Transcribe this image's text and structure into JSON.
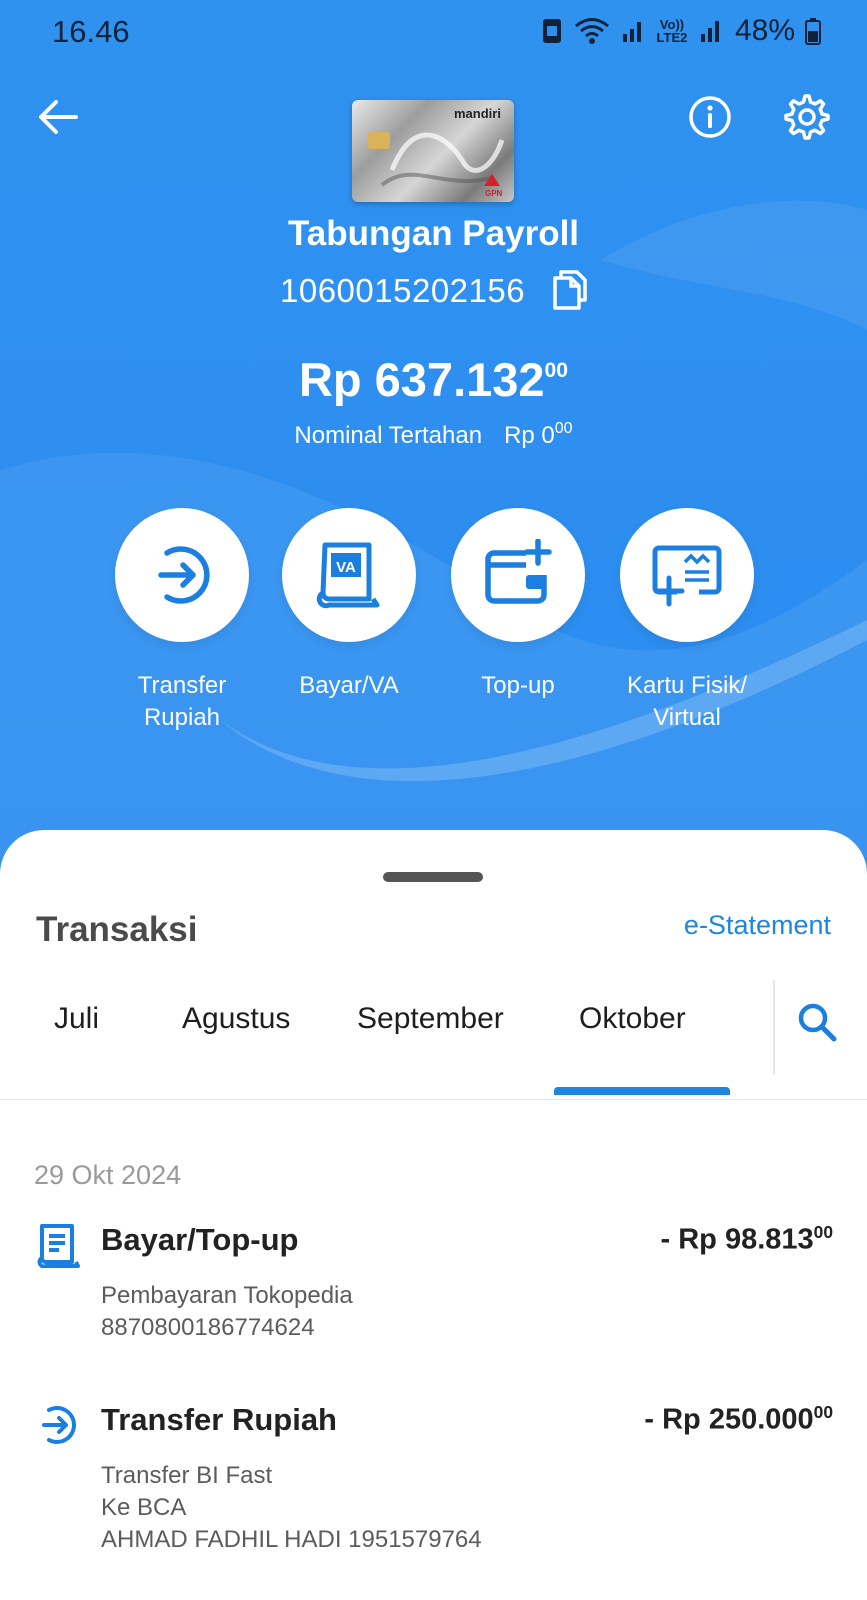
{
  "status_bar": {
    "time": "16.46",
    "network_label": "Vo)) LTE2",
    "battery": "48%"
  },
  "account": {
    "name": "Tabungan Payroll",
    "number": "1060015202156",
    "card_brand": "mandiri",
    "card_network": "GPN"
  },
  "balance": {
    "amount": "Rp 637.132",
    "decimals": "00",
    "hold_label": "Nominal Tertahan",
    "hold_amount": "Rp 0",
    "hold_decimals": "00"
  },
  "actions": [
    {
      "label": "Transfer\nRupiah",
      "icon": "transfer-icon"
    },
    {
      "label": "Bayar/VA",
      "icon": "va-icon"
    },
    {
      "label": "Top-up",
      "icon": "wallet-plus-icon"
    },
    {
      "label": "Kartu Fisik/\nVirtual",
      "icon": "card-plus-icon"
    }
  ],
  "transactions_panel": {
    "title": "Transaksi",
    "estatement_label": "e-Statement",
    "tabs": [
      "Juli",
      "Agustus",
      "September",
      "Oktober"
    ],
    "active_tab": "Oktober",
    "date": "29 Okt 2024",
    "items": [
      {
        "title": "Bayar/Top-up",
        "amount": "- Rp 98.813",
        "decimals": "00",
        "lines": [
          "Pembayaran Tokopedia",
          "8870800186774624"
        ],
        "icon": "receipt-icon"
      },
      {
        "title": "Transfer Rupiah",
        "amount": "- Rp 250.000",
        "decimals": "00",
        "lines": [
          "Transfer BI Fast",
          "Ke BCA",
          "AHMAD FADHIL HADI 1951579764"
        ],
        "icon": "transfer-icon"
      }
    ]
  },
  "colors": {
    "header_blue": "#2e8ff0",
    "accent_blue": "#1f86de",
    "icon_blue": "#1b7fe0"
  }
}
